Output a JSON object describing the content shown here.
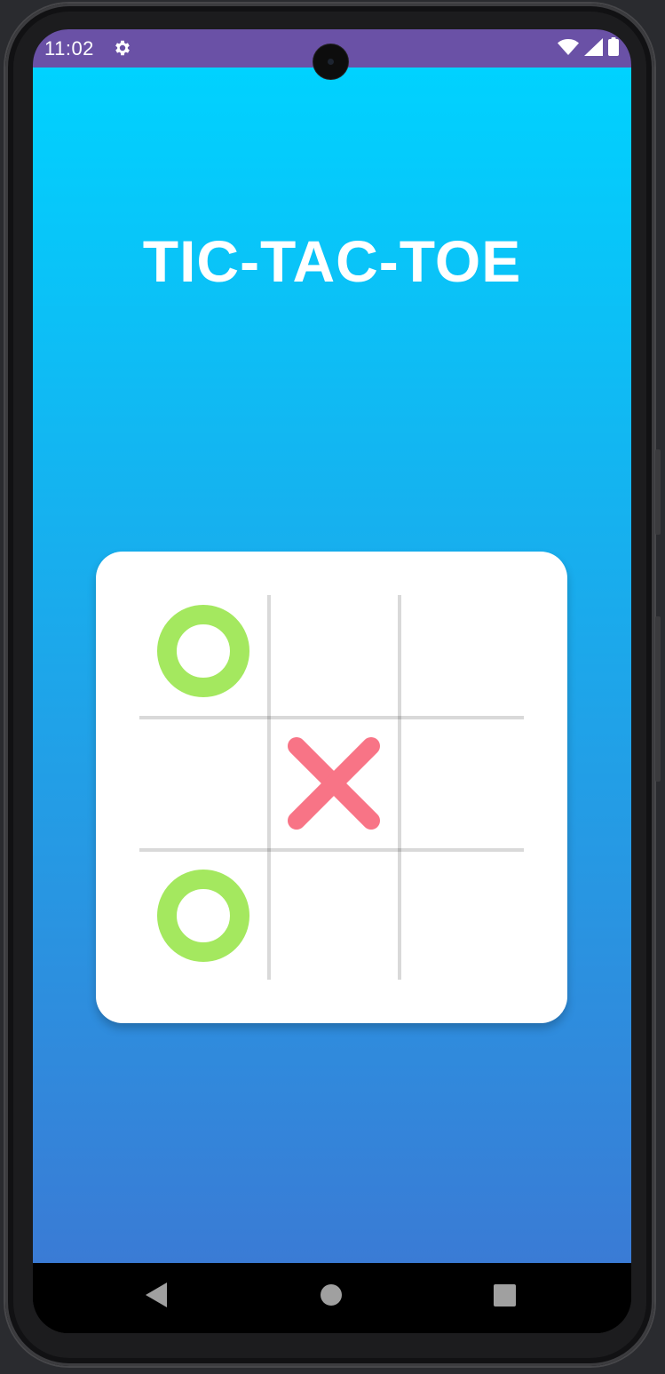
{
  "status_bar": {
    "time": "11:02",
    "background_color": "#6a51a6",
    "icons": [
      "settings-gear-icon",
      "wifi-icon",
      "cell-signal-icon",
      "battery-icon"
    ]
  },
  "app": {
    "title": "TIC-TAC-TOE",
    "gradient_top": "#00d2ff",
    "gradient_bottom": "#3a7bd5"
  },
  "board": {
    "cells": [
      [
        "O",
        "",
        ""
      ],
      [
        "",
        "X",
        ""
      ],
      [
        "O",
        "",
        ""
      ]
    ],
    "o_color": "#a4e85f",
    "x_color": "#f87486"
  },
  "nav_bar": {
    "buttons": [
      "back-icon",
      "home-icon",
      "recents-icon"
    ]
  }
}
